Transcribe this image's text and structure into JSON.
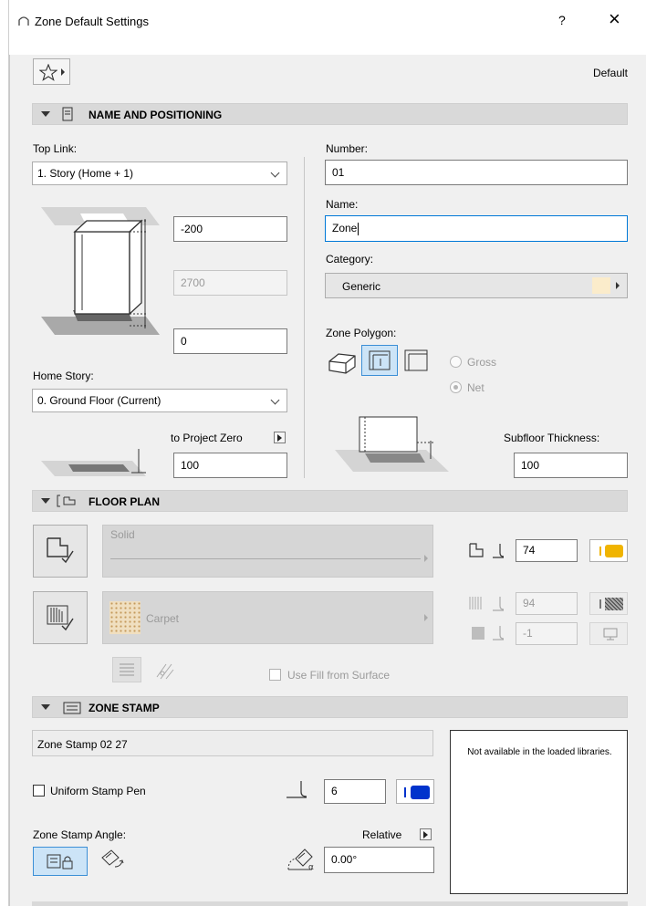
{
  "window": {
    "title": "Zone Default Settings",
    "help_label": "?",
    "close_label": "×"
  },
  "toolbar": {
    "preset_label": "Default"
  },
  "name_positioning": {
    "header": "NAME AND POSITIONING",
    "top_link_label": "Top Link:",
    "top_link_value": "1. Story (Home + 1)",
    "top_offset": "-200",
    "height": "2700",
    "bottom_offset": "0",
    "home_story_label": "Home Story:",
    "home_story_value": "0. Ground Floor (Current)",
    "to_project_zero_label": "to Project Zero",
    "project_zero_value": "100",
    "number_label": "Number:",
    "number_value": "01",
    "name_label": "Name:",
    "name_value": "Zone",
    "category_label": "Category:",
    "category_value": "Generic",
    "zone_polygon_label": "Zone Polygon:",
    "gross_label": "Gross",
    "net_label": "Net",
    "subfloor_label": "Subfloor Thickness:",
    "subfloor_value": "100"
  },
  "floor_plan": {
    "header": "FLOOR PLAN",
    "contour_line_label": "Solid",
    "fill_label": "Carpet",
    "contour_pen": "74",
    "fill_pen": "94",
    "background_pen": "-1",
    "use_fill_label": "Use Fill from Surface"
  },
  "zone_stamp": {
    "header": "ZONE STAMP",
    "stamp_name": "Zone Stamp 02 27",
    "preview_message": "Not available in the loaded libraries.",
    "uniform_pen_label": "Uniform Stamp Pen",
    "stamp_pen": "6",
    "angle_label": "Zone Stamp Angle:",
    "relative_label": "Relative",
    "angle_value": "0.00°"
  },
  "colors": {
    "accent": "#0078d7",
    "pen_orange": "#f0b400",
    "pen_blue": "#0033cc",
    "category_swatch": "#fbeccb"
  }
}
